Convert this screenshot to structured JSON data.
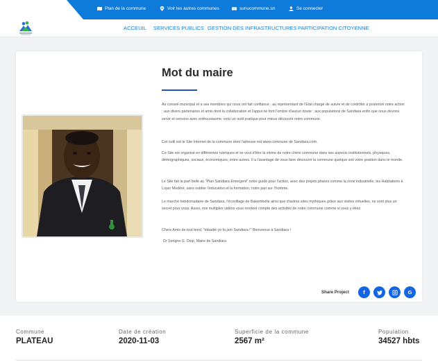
{
  "topbar": {
    "links": [
      {
        "label": "Plan de la commune",
        "icon": "map-icon"
      },
      {
        "label": "Voir les autres communes",
        "icon": "location-pin-icon"
      },
      {
        "label": "sunucommune.sn",
        "icon": "mail-icon"
      },
      {
        "label": "Se connecter",
        "icon": "user-icon"
      }
    ],
    "accent_color": "#0e7ad9"
  },
  "nav": {
    "items": [
      "ACCEUIL",
      "SERVICES PUBLICS",
      "GESTION DES INFRASTRUCTURES",
      "PARTICIPATION CITOYENNE"
    ],
    "link_color": "#1a7fd6"
  },
  "article": {
    "title": "Mot du maire",
    "paragraphs": [
      "Au conseil municipal et à ses membres qui nous ont fait confiance ; au représentant de l'Etat chargé de suivre et de contrôler a posteriori notre action ; aux divers partenaires et amis dont la collaboration et l'appui ne font l'ombre d'aucun doute ; aux populations de Sandiara enfin que nous devons servir et servons avec enthousiasme, voici un outil pratique pour mieux découvrir notre commune.",
      "Cet outil est le Site Internet de la commune dont l'adresse est www.commune de Sandiara.com.",
      "Ce Site est organisé en différentes rubriques et se veut d'être la vitrine de notre chère commune dans ses aspects institutionnels, physiques, démographiques, sociaux, économiques, entre autres. Il a l'avantage de vous faire découvrir la commune quelque soit votre position dans le monde.",
      "Le Site fait la part belle au \"Plan Sandiara Emergent\" notre guide pour l'action, avec des projets phares comme la zone industrielle, les Habitations à Loyer Modéré, sans oublier l'éducation et la formation, notre pari sur l'homme.",
      "Le marché hebdomadaire de Sandiara, l'écovillage de Bakombelle ainsi que d'autres sites mythiques grâce aux visites virtuelles, ne sont plus un secret pour vous. Aussi, nos multiples vidéos vous rendent compte des activités de notre commune comme si vous y étiez.",
      "Chers Amis de tout bord, \"mbadiè yo fa jam Sandiara !\" Bienvenue à Sandiara !",
      "Dr Serigne G. Diop, Maire de Sandiara"
    ],
    "share_label": "Share Project",
    "share_buttons": [
      {
        "icon": "facebook-icon",
        "glyph": "f"
      },
      {
        "icon": "twitter-icon"
      },
      {
        "icon": "instagram-icon"
      },
      {
        "icon": "google-icon",
        "glyph": "G"
      }
    ],
    "share_color": "#1565e0"
  },
  "stats": [
    {
      "label": "Commune",
      "value": "PLATEAU"
    },
    {
      "label": "Date de création",
      "value": "2020-11-03"
    },
    {
      "label": "Superficie de la commune",
      "value": "2567 m²"
    },
    {
      "label": "Population",
      "value": "34527 hbts"
    }
  ]
}
